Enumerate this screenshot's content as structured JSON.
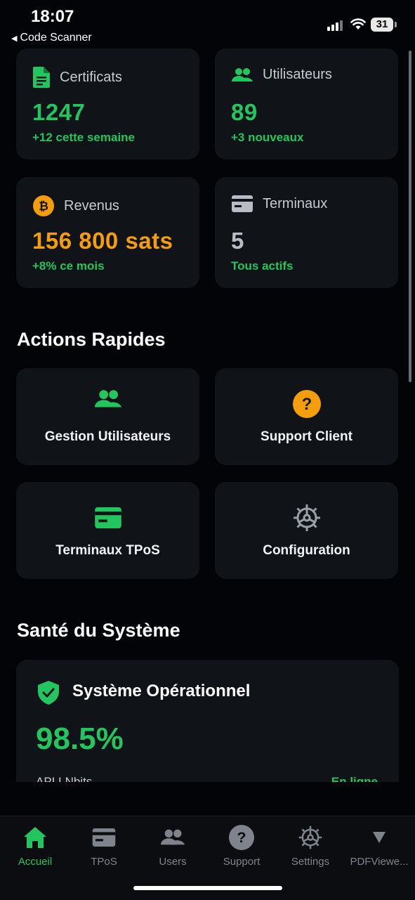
{
  "status": {
    "time": "18:07",
    "back_label": "Code Scanner",
    "battery": "31"
  },
  "stats": [
    {
      "icon": "document-icon",
      "label": "Certificats",
      "value": "1247",
      "sub": "+12 cette semaine",
      "value_color": "#22c55e"
    },
    {
      "icon": "users-icon",
      "label": "Utilisateurs",
      "value": "89",
      "sub": "+3 nouveaux",
      "value_color": "#22c55e"
    },
    {
      "icon": "bitcoin-icon",
      "label": "Revenus",
      "value": "156 800 sats",
      "sub": "+8% ce mois",
      "value_color": "#f59e0b"
    },
    {
      "icon": "card-icon",
      "label": "Terminaux",
      "value": "5",
      "sub": "Tous actifs",
      "value_color": "#b8bcc4"
    }
  ],
  "quick_actions": {
    "title": "Actions Rapides",
    "items": [
      {
        "icon": "users-icon",
        "label": "Gestion Utilisateurs"
      },
      {
        "icon": "help-icon",
        "label": "Support Client"
      },
      {
        "icon": "card-icon",
        "label": "Terminaux TPoS"
      },
      {
        "icon": "gear-icon",
        "label": "Configuration"
      }
    ]
  },
  "health": {
    "title": "Santé du Système",
    "status_title": "Système Opérationnel",
    "percent": "98.5%",
    "row_label": "API LNbits",
    "row_status": "En ligne"
  },
  "tabs": [
    {
      "label": "Accueil",
      "icon": "home-icon",
      "active": true
    },
    {
      "label": "TPoS",
      "icon": "card-icon"
    },
    {
      "label": "Users",
      "icon": "users-icon"
    },
    {
      "label": "Support",
      "icon": "help-icon"
    },
    {
      "label": "Settings",
      "icon": "gear-icon"
    },
    {
      "label": "PDFViewe...",
      "icon": "caret-down-icon"
    }
  ],
  "colors": {
    "accent": "#22c55e",
    "orange": "#f59e0b",
    "card": "#101418",
    "background": "#030407"
  }
}
